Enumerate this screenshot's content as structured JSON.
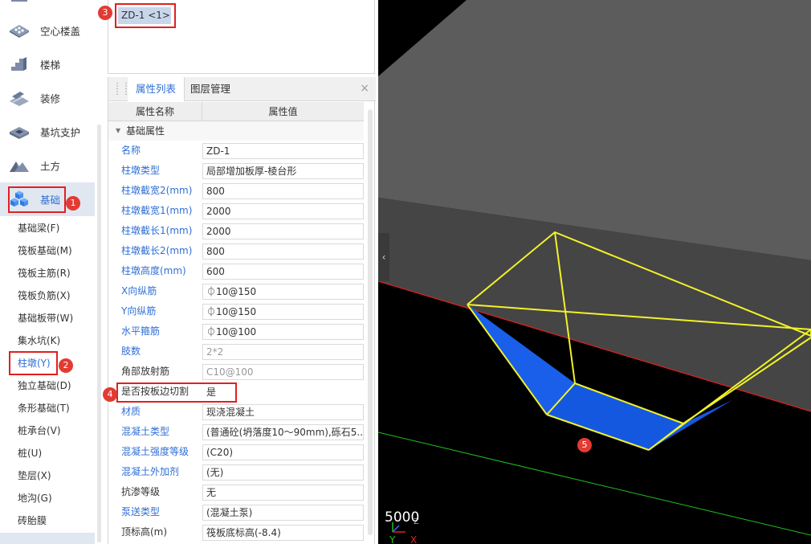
{
  "nav": {
    "categories": [
      {
        "label": "空心楼盖",
        "icon": "hollow-slab-icon"
      },
      {
        "label": "楼梯",
        "icon": "stairs-icon"
      },
      {
        "label": "装修",
        "icon": "decoration-icon"
      },
      {
        "label": "基坑支护",
        "icon": "pit-support-icon"
      },
      {
        "label": "土方",
        "icon": "earthwork-icon"
      },
      {
        "label": "基础",
        "icon": "foundation-icon"
      }
    ],
    "subitems": [
      "基础梁(F)",
      "筏板基础(M)",
      "筏板主筋(R)",
      "筏板负筋(X)",
      "基础板带(W)",
      "集水坑(K)",
      "柱墩(Y)",
      "独立基础(D)",
      "条形基础(T)",
      "桩承台(V)",
      "桩(U)",
      "垫层(X)",
      "地沟(G)",
      "砖胎膜"
    ],
    "active_category": "基础",
    "active_subitem": "柱墩(Y)"
  },
  "markers": [
    "1",
    "2",
    "3",
    "4",
    "5"
  ],
  "element_list": {
    "item": "ZD-1 <1>"
  },
  "properties": {
    "tabs": {
      "props": "属性列表",
      "layers": "图层管理",
      "close": "×"
    },
    "header": {
      "name": "属性名称",
      "value": "属性值"
    },
    "group": "基础属性",
    "rows": [
      {
        "name": "名称",
        "value": "ZD-1",
        "style": "blue"
      },
      {
        "name": "柱墩类型",
        "value": "局部增加板厚-棱台形",
        "style": "blue"
      },
      {
        "name": "柱墩截宽2(mm)",
        "value": "800",
        "style": "blue"
      },
      {
        "name": "柱墩截宽1(mm)",
        "value": "2000",
        "style": "blue"
      },
      {
        "name": "柱墩截长1(mm)",
        "value": "2000",
        "style": "blue"
      },
      {
        "name": "柱墩截长2(mm)",
        "value": "800",
        "style": "blue"
      },
      {
        "name": "柱墩高度(mm)",
        "value": "600",
        "style": "blue"
      },
      {
        "name": "X向纵筋",
        "value": "⏀10@150",
        "style": "blue"
      },
      {
        "name": "Y向纵筋",
        "value": "⏀10@150",
        "style": "blue"
      },
      {
        "name": "水平箍筋",
        "value": "⏀10@100",
        "style": "blue"
      },
      {
        "name": "肢数",
        "value": "2*2",
        "style": "blue",
        "muted": true
      },
      {
        "name": "角部放射筋",
        "value": "C10@100",
        "style": "gray",
        "muted": true
      },
      {
        "name": "是否按板边切割",
        "value": "是",
        "style": "gray",
        "plain": true
      },
      {
        "name": "材质",
        "value": "现浇混凝土",
        "style": "blue"
      },
      {
        "name": "混凝土类型",
        "value": "(普通砼(坍落度10～90mm),砾石5...",
        "style": "blue"
      },
      {
        "name": "混凝土强度等级",
        "value": "(C20)",
        "style": "blue"
      },
      {
        "name": "混凝土外加剂",
        "value": "(无)",
        "style": "blue"
      },
      {
        "name": "抗渗等级",
        "value": "无",
        "style": "gray"
      },
      {
        "name": "泵送类型",
        "value": "(混凝土泵)",
        "style": "blue"
      },
      {
        "name": "顶标高(m)",
        "value": "筏板底标高(-8.4)",
        "style": "gray"
      }
    ]
  },
  "viewport": {
    "scale_text": "5000",
    "axis_labels": {
      "x": "X",
      "y": "Y",
      "z": "Z"
    },
    "colors": {
      "slab": "#5c5c5c",
      "pier_fill": "#1558e0",
      "pier_edges": "#f2f22a",
      "x_axis": "#e02020",
      "y_axis": "#1fbf1f"
    }
  }
}
